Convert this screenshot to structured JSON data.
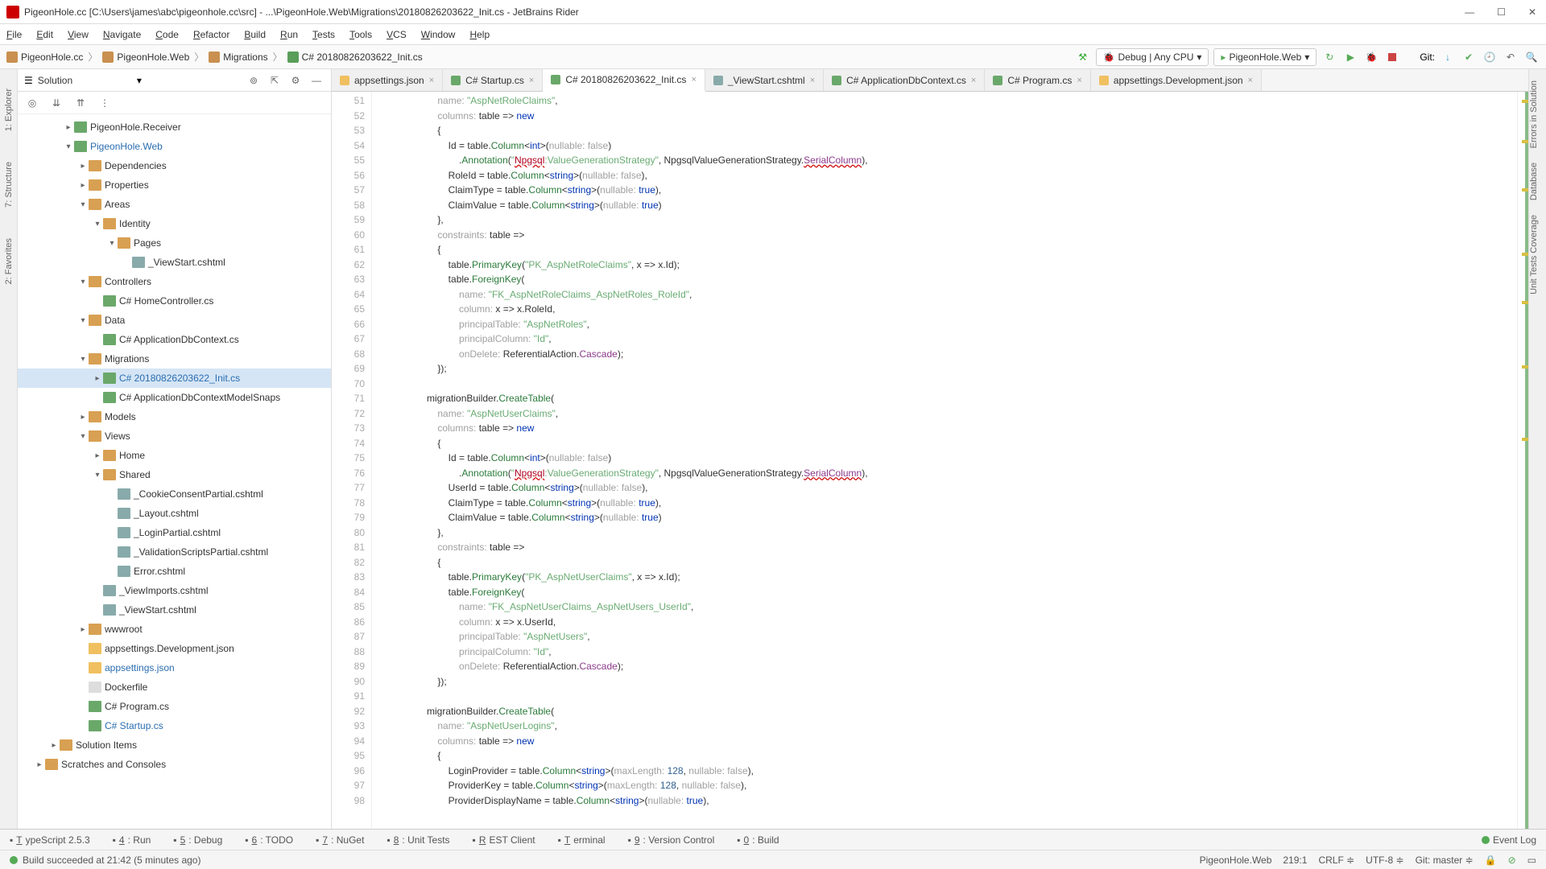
{
  "title": "PigeonHole.cc [C:\\Users\\james\\abc\\pigeonhole.cc\\src] - ...\\PigeonHole.Web\\Migrations\\20180826203622_Init.cs - JetBrains Rider",
  "menu": [
    "File",
    "Edit",
    "View",
    "Navigate",
    "Code",
    "Refactor",
    "Build",
    "Run",
    "Tests",
    "Tools",
    "VCS",
    "Window",
    "Help"
  ],
  "breadcrumbs": [
    "PigeonHole.cc",
    "PigeonHole.Web",
    "Migrations",
    "C# 20180826203622_Init.cs"
  ],
  "run_config": "Debug | Any CPU",
  "run_target": "PigeonHole.Web",
  "git_label": "Git:",
  "panel_title": "Solution",
  "tree": [
    {
      "depth": 2,
      "arrow": ">",
      "icon": "ico-proj",
      "label": "PigeonHole.Receiver"
    },
    {
      "depth": 2,
      "arrow": "v",
      "icon": "ico-proj",
      "label": "PigeonHole.Web",
      "accent": true
    },
    {
      "depth": 3,
      "arrow": ">",
      "icon": "ico-folder",
      "label": "Dependencies"
    },
    {
      "depth": 3,
      "arrow": ">",
      "icon": "ico-folder",
      "label": "Properties"
    },
    {
      "depth": 3,
      "arrow": "v",
      "icon": "ico-folder",
      "label": "Areas"
    },
    {
      "depth": 4,
      "arrow": "v",
      "icon": "ico-folder",
      "label": "Identity"
    },
    {
      "depth": 5,
      "arrow": "v",
      "icon": "ico-folder",
      "label": "Pages"
    },
    {
      "depth": 6,
      "arrow": "",
      "icon": "ico-razor",
      "label": "_ViewStart.cshtml"
    },
    {
      "depth": 3,
      "arrow": "v",
      "icon": "ico-folder",
      "label": "Controllers"
    },
    {
      "depth": 4,
      "arrow": "",
      "icon": "ico-cs",
      "label": "C# HomeController.cs"
    },
    {
      "depth": 3,
      "arrow": "v",
      "icon": "ico-folder",
      "label": "Data"
    },
    {
      "depth": 4,
      "arrow": "",
      "icon": "ico-cs",
      "label": "C# ApplicationDbContext.cs"
    },
    {
      "depth": 3,
      "arrow": "v",
      "icon": "ico-folder",
      "label": "Migrations"
    },
    {
      "depth": 4,
      "arrow": ">",
      "icon": "ico-cs",
      "label": "C# 20180826203622_Init.cs",
      "accent": true,
      "selected": true
    },
    {
      "depth": 4,
      "arrow": "",
      "icon": "ico-cs",
      "label": "C# ApplicationDbContextModelSnaps"
    },
    {
      "depth": 3,
      "arrow": ">",
      "icon": "ico-folder",
      "label": "Models"
    },
    {
      "depth": 3,
      "arrow": "v",
      "icon": "ico-folder",
      "label": "Views"
    },
    {
      "depth": 4,
      "arrow": ">",
      "icon": "ico-folder",
      "label": "Home"
    },
    {
      "depth": 4,
      "arrow": "v",
      "icon": "ico-folder",
      "label": "Shared"
    },
    {
      "depth": 5,
      "arrow": "",
      "icon": "ico-razor",
      "label": "_CookieConsentPartial.cshtml"
    },
    {
      "depth": 5,
      "arrow": "",
      "icon": "ico-razor",
      "label": "_Layout.cshtml"
    },
    {
      "depth": 5,
      "arrow": "",
      "icon": "ico-razor",
      "label": "_LoginPartial.cshtml"
    },
    {
      "depth": 5,
      "arrow": "",
      "icon": "ico-razor",
      "label": "_ValidationScriptsPartial.cshtml"
    },
    {
      "depth": 5,
      "arrow": "",
      "icon": "ico-razor",
      "label": "Error.cshtml"
    },
    {
      "depth": 4,
      "arrow": "",
      "icon": "ico-razor",
      "label": "_ViewImports.cshtml"
    },
    {
      "depth": 4,
      "arrow": "",
      "icon": "ico-razor",
      "label": "_ViewStart.cshtml"
    },
    {
      "depth": 3,
      "arrow": ">",
      "icon": "ico-folder",
      "label": "wwwroot"
    },
    {
      "depth": 3,
      "arrow": "",
      "icon": "ico-json",
      "label": "appsettings.Development.json"
    },
    {
      "depth": 3,
      "arrow": "",
      "icon": "ico-json",
      "label": "appsettings.json",
      "accent": true
    },
    {
      "depth": 3,
      "arrow": "",
      "icon": "ico-file",
      "label": "Dockerfile"
    },
    {
      "depth": 3,
      "arrow": "",
      "icon": "ico-cs",
      "label": "C# Program.cs"
    },
    {
      "depth": 3,
      "arrow": "",
      "icon": "ico-cs",
      "label": "C# Startup.cs",
      "accent": true
    },
    {
      "depth": 1,
      "arrow": ">",
      "icon": "ico-folder",
      "label": "Solution Items"
    },
    {
      "depth": 0,
      "arrow": ">",
      "icon": "ico-folder",
      "label": "Scratches and Consoles"
    }
  ],
  "tabs": [
    {
      "label": "appsettings.json",
      "icon": "#f0c060"
    },
    {
      "label": "C# Startup.cs",
      "icon": "#6aa86a"
    },
    {
      "label": "C# 20180826203622_Init.cs",
      "icon": "#6aa86a",
      "active": true
    },
    {
      "label": "_ViewStart.cshtml",
      "icon": "#8aa"
    },
    {
      "label": "C# ApplicationDbContext.cs",
      "icon": "#6aa86a"
    },
    {
      "label": "C# Program.cs",
      "icon": "#6aa86a"
    },
    {
      "label": "appsettings.Development.json",
      "icon": "#f0c060"
    }
  ],
  "first_line_no": 51,
  "last_line_no": 98,
  "code_lines": [
    "                <span class='dim'>name:</span> <span class='str'>\"AspNetRoleClaims\"</span>,",
    "                <span class='dim'>columns:</span> table => <span class='kw'>new</span>",
    "                {",
    "                    Id = table.<span class='fn'>Column</span>&lt;<span class='kw'>int</span>&gt;(<span class='dim'>nullable: false</span>)",
    "                        .<span class='fn'>Annotation</span>(<span class='str'>\"<span class='err'>Npgsql</span>:ValueGenerationStrategy\"</span>, NpgsqlValueGenerationStrategy.<span class='err' style='color:#8b3a8b'>SerialColumn</span>),",
    "                    RoleId = table.<span class='fn'>Column</span>&lt;<span class='kw'>string</span>&gt;(<span class='dim'>nullable: false</span>),",
    "                    ClaimType = table.<span class='fn'>Column</span>&lt;<span class='kw'>string</span>&gt;(<span class='dim'>nullable:</span> <span class='kw'>true</span>),",
    "                    ClaimValue = table.<span class='fn'>Column</span>&lt;<span class='kw'>string</span>&gt;(<span class='dim'>nullable:</span> <span class='kw'>true</span>)",
    "                },",
    "                <span class='dim'>constraints:</span> table =>",
    "                {",
    "                    table.<span class='fn'>PrimaryKey</span>(<span class='str'>\"PK_AspNetRoleClaims\"</span>, x => x.Id);",
    "                    table.<span class='fn'>ForeignKey</span>(",
    "                        <span class='dim'>name:</span> <span class='str'>\"FK_AspNetRoleClaims_AspNetRoles_RoleId\"</span>,",
    "                        <span class='dim'>column:</span> x => x.RoleId,",
    "                        <span class='dim'>principalTable:</span> <span class='str'>\"AspNetRoles\"</span>,",
    "                        <span class='dim'>principalColumn:</span> <span class='str'>\"Id\"</span>,",
    "                        <span class='dim'>onDelete:</span> ReferentialAction.<span class='purp'>Cascade</span>);",
    "                });",
    "",
    "            migrationBuilder.<span class='fn'>CreateTable</span>(",
    "                <span class='dim'>name:</span> <span class='str'>\"AspNetUserClaims\"</span>,",
    "                <span class='dim'>columns:</span> table => <span class='kw'>new</span>",
    "                {",
    "                    Id = table.<span class='fn'>Column</span>&lt;<span class='kw'>int</span>&gt;(<span class='dim'>nullable: false</span>)",
    "                        .<span class='fn'>Annotation</span>(<span class='str'>\"<span class='err'>Npgsql</span>:ValueGenerationStrategy\"</span>, NpgsqlValueGenerationStrategy.<span class='err' style='color:#8b3a8b'>SerialColumn</span>),",
    "                    UserId = table.<span class='fn'>Column</span>&lt;<span class='kw'>string</span>&gt;(<span class='dim'>nullable: false</span>),",
    "                    ClaimType = table.<span class='fn'>Column</span>&lt;<span class='kw'>string</span>&gt;(<span class='dim'>nullable:</span> <span class='kw'>true</span>),",
    "                    ClaimValue = table.<span class='fn'>Column</span>&lt;<span class='kw'>string</span>&gt;(<span class='dim'>nullable:</span> <span class='kw'>true</span>)",
    "                },",
    "                <span class='dim'>constraints:</span> table =>",
    "                {",
    "                    table.<span class='fn'>PrimaryKey</span>(<span class='str'>\"PK_AspNetUserClaims\"</span>, x => x.Id);",
    "                    table.<span class='fn'>ForeignKey</span>(",
    "                        <span class='dim'>name:</span> <span class='str'>\"FK_AspNetUserClaims_AspNetUsers_UserId\"</span>,",
    "                        <span class='dim'>column:</span> x => x.UserId,",
    "                        <span class='dim'>principalTable:</span> <span class='str'>\"AspNetUsers\"</span>,",
    "                        <span class='dim'>principalColumn:</span> <span class='str'>\"Id\"</span>,",
    "                        <span class='dim'>onDelete:</span> ReferentialAction.<span class='purp'>Cascade</span>);",
    "                });",
    "",
    "            migrationBuilder.<span class='fn'>CreateTable</span>(",
    "                <span class='dim'>name:</span> <span class='str'>\"AspNetUserLogins\"</span>,",
    "                <span class='dim'>columns:</span> table => <span class='kw'>new</span>",
    "                {",
    "                    LoginProvider = table.<span class='fn'>Column</span>&lt;<span class='kw'>string</span>&gt;(<span class='dim'>maxLength:</span> <span class='num'>128</span>, <span class='dim'>nullable: false</span>),",
    "                    ProviderKey = table.<span class='fn'>Column</span>&lt;<span class='kw'>string</span>&gt;(<span class='dim'>maxLength:</span> <span class='num'>128</span>, <span class='dim'>nullable: false</span>),",
    "                    ProviderDisplayName = table.<span class='fn'>Column</span>&lt;<span class='kw'>string</span>&gt;(<span class='dim'>nullable:</span> <span class='kw'>true</span>),"
  ],
  "bottom_tabs": [
    "TypeScript 2.5.3",
    "4: Run",
    "5: Debug",
    "6: TODO",
    "7: NuGet",
    "8: Unit Tests",
    "REST Client",
    "Terminal",
    "9: Version Control",
    "0: Build"
  ],
  "event_log": "Event Log",
  "status_left": "Build succeeded at 21:42 (5 minutes ago)",
  "status_right": {
    "project": "PigeonHole.Web",
    "pos": "219:1",
    "eol": "CRLF",
    "enc": "UTF-8",
    "branch": "Git: master"
  },
  "side_left": [
    "1: Explorer",
    "7: Structure",
    "2: Favorites"
  ],
  "side_right": [
    "Errors in Solution",
    "Database",
    "Unit Tests Coverage"
  ]
}
